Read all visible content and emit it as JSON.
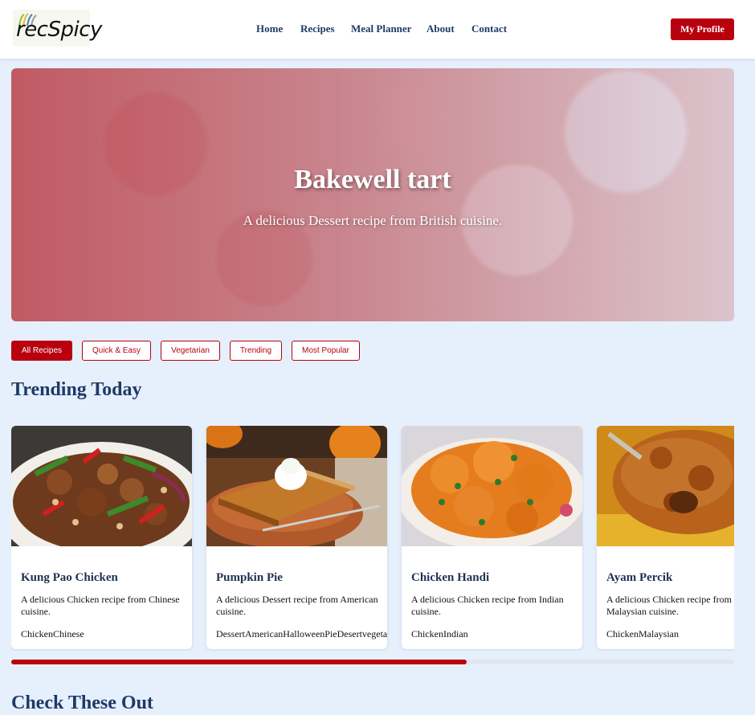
{
  "brand": {
    "logo_text": "recSpicy"
  },
  "nav": {
    "items": [
      {
        "label": "Home"
      },
      {
        "label": "Recipes"
      },
      {
        "label": "Meal Planner"
      },
      {
        "label": "About"
      },
      {
        "label": "Contact"
      }
    ],
    "profile_label": "My Profile"
  },
  "hero": {
    "title": "Bakewell tart",
    "subtitle": "A delicious Dessert recipe from British cuisine."
  },
  "filters": [
    {
      "label": "All Recipes",
      "active": true
    },
    {
      "label": "Quick & Easy",
      "active": false
    },
    {
      "label": "Vegetarian",
      "active": false
    },
    {
      "label": "Trending",
      "active": false
    },
    {
      "label": "Most Popular",
      "active": false
    }
  ],
  "trending": {
    "title": "Trending Today",
    "cards": [
      {
        "title": "Kung Pao Chicken",
        "description": "A delicious Chicken recipe from Chinese cuisine.",
        "tags": "ChickenChinese"
      },
      {
        "title": "Pumpkin Pie",
        "description": "A delicious Dessert recipe from American cuisine.",
        "tags": "DessertAmericanHalloweenPieDesertvegetarian"
      },
      {
        "title": "Chicken Handi",
        "description": "A delicious Chicken recipe from Indian cuisine.",
        "tags": "ChickenIndian"
      },
      {
        "title": "Ayam Percik",
        "description": "A delicious Chicken recipe from Malaysian cuisine.",
        "tags": "ChickenMalaysian"
      }
    ],
    "scroll_progress": 0.63
  },
  "check_out": {
    "title": "Check These Out"
  },
  "colors": {
    "accent": "#b8000f",
    "heading": "#1e3a66",
    "background": "#e6effc"
  }
}
